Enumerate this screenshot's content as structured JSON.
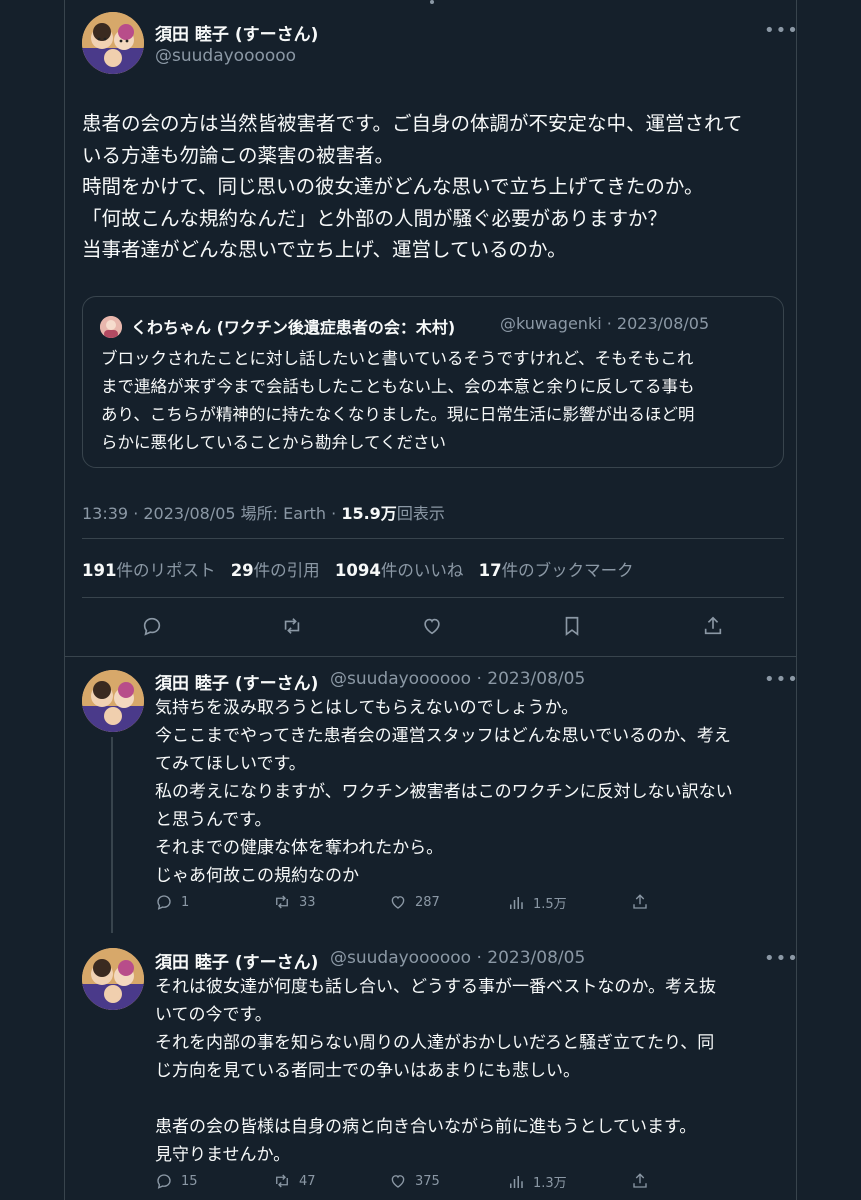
{
  "colors": {
    "background": "#15202b",
    "text": "#f7f9f9",
    "secondary": "#8b98a5",
    "border": "#38444d"
  },
  "main_tweet": {
    "author_name": "須田 睦子 (すーさん)",
    "author_handle": "@suudayoooooo",
    "more_icon": "more-horizontal-icon",
    "text_lines": [
      "患者の会の方は当然皆被害者です。ご自身の体調が不安定な中、運営されて",
      "いる方達も勿論この薬害の被害者。",
      "時間をかけて、同じ思いの彼女達がどんな思いで立ち上げてきたのか。",
      "「何故こんな規約なんだ」と外部の人間が騒ぐ必要がありますか？",
      "当事者達がどんな思いで立ち上げ、運営しているのか。"
    ],
    "quote": {
      "author_name": "くわちゃん (ワクチン後遺症患者の会：木村)",
      "author_handle_date": "@kuwagenki · 2023/08/05",
      "text_lines": [
        "ブロックされたことに対し話したいと書いているそうですけれど、そもそもこれ",
        "まで連絡が来ず今まで会話もしたこともない上、会の本意と余りに反してる事も",
        "あり、こちらが精神的に持たなくなりました。現に日常生活に影響が出るほど明",
        "らかに悪化していることから勘弁してください"
      ]
    },
    "meta": {
      "time_date_location": "13:39 · 2023/08/05 場所: Earth · ",
      "views_count": "15.9万",
      "views_label": "回表示"
    },
    "stats": {
      "reposts_count": "191",
      "reposts_label": "件のリポスト",
      "quotes_count": "29",
      "quotes_label": "件の引用",
      "likes_count": "1094",
      "likes_label": "件のいいね",
      "bookmarks_count": "17",
      "bookmarks_label": "件のブックマーク"
    },
    "actions": [
      "reply-icon",
      "repost-icon",
      "like-icon",
      "bookmark-icon",
      "share-icon"
    ]
  },
  "replies": [
    {
      "author_name": "須田 睦子 (すーさん)",
      "author_handle_date": "@suudayoooooo · 2023/08/05",
      "text_lines": [
        "気持ちを汲み取ろうとはしてもらえないのでしょうか。",
        "今ここまでやってきた患者会の運営スタッフはどんな思いでいるのか、考え",
        "てみてほしいです。",
        "私の考えになりますが、ワクチン被害者はこのワクチンに反対しない訳ない",
        "と思うんです。",
        "それまでの健康な体を奪われたから。",
        "じゃあ何故この規約なのか"
      ],
      "replies_count": "1",
      "reposts_count": "33",
      "likes_count": "287",
      "views_count": "1.5万"
    },
    {
      "author_name": "須田 睦子 (すーさん)",
      "author_handle_date": "@suudayoooooo · 2023/08/05",
      "text_lines": [
        "それは彼女達が何度も話し合い、どうする事が一番ベストなのか。考え抜",
        "いての今です。",
        "それを内部の事を知らない周りの人達がおかしいだろと騒ぎ立てたり、同",
        "じ方向を見ている者同士での争いはあまりにも悲しい。",
        "",
        "患者の会の皆様は自身の病と向き合いながら前に進もうとしています。",
        "見守りませんか。"
      ],
      "replies_count": "15",
      "reposts_count": "47",
      "likes_count": "375",
      "views_count": "1.3万"
    }
  ]
}
